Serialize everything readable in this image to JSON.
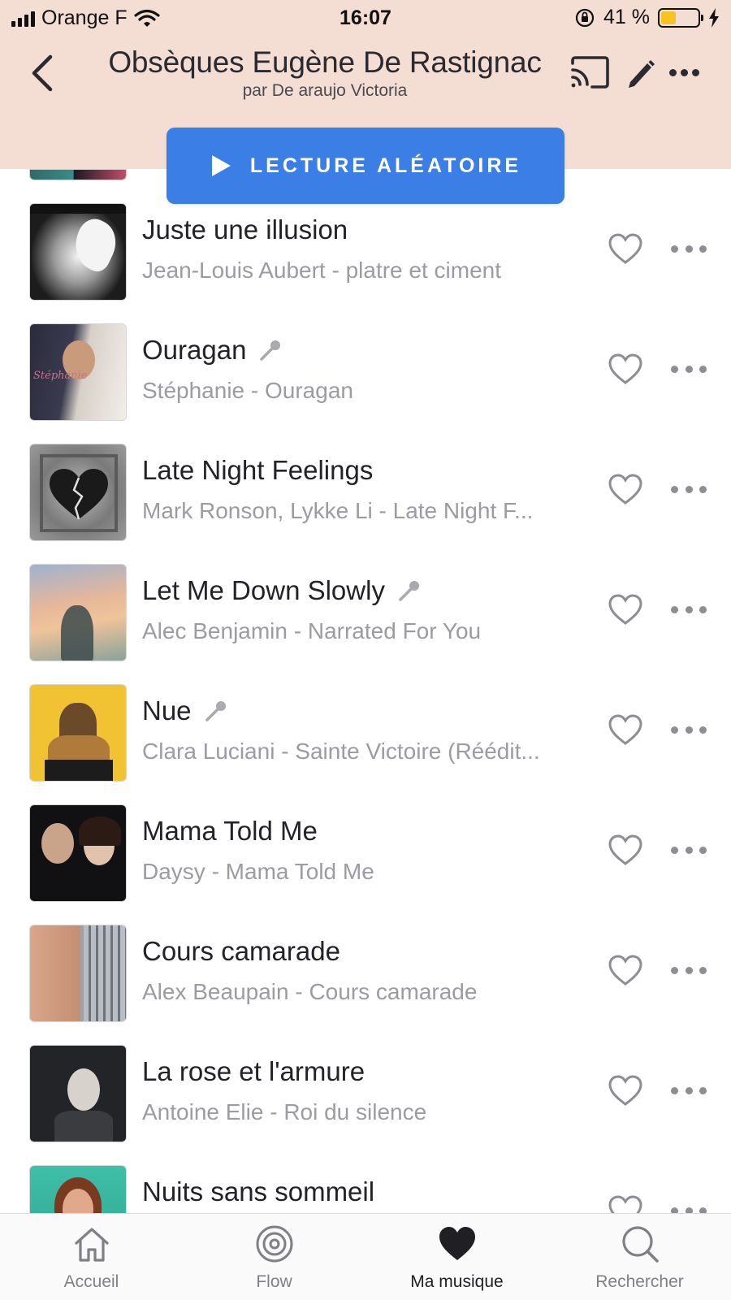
{
  "status_bar": {
    "carrier": "Orange F",
    "time": "16:07",
    "battery_percent": "41 %",
    "battery_level": 0.41
  },
  "header": {
    "title": "Obsèques Eugène De Rastignac",
    "subtitle": "par De araujo Victoria",
    "icons": [
      "back-chevron-icon",
      "cast-icon",
      "pencil-icon",
      "more-icon"
    ]
  },
  "shuffle_button": {
    "label": "LECTURE ALÉATOIRE"
  },
  "tracks": [
    {
      "title": "Juste une illusion",
      "subtitle": "Jean-Louis Aubert - platre et ciment",
      "edited": false
    },
    {
      "title": "Ouragan",
      "subtitle": "Stéphanie - Ouragan",
      "edited": true
    },
    {
      "title": "Late Night Feelings",
      "subtitle": "Mark Ronson, Lykke Li - Late Night F...",
      "edited": false
    },
    {
      "title": "Let Me Down Slowly",
      "subtitle": "Alec Benjamin - Narrated For You",
      "edited": true
    },
    {
      "title": "Nue",
      "subtitle": "Clara Luciani - Sainte Victoire (Réédit...",
      "edited": true
    },
    {
      "title": "Mama Told Me",
      "subtitle": "Daysy - Mama Told Me",
      "edited": false
    },
    {
      "title": "Cours camarade",
      "subtitle": "Alex Beaupain - Cours camarade",
      "edited": false
    },
    {
      "title": "La rose et l'armure",
      "subtitle": "Antoine Elie - Roi du silence",
      "edited": false
    },
    {
      "title": "Nuits sans sommeil",
      "subtitle": "",
      "edited": false
    }
  ],
  "tab_bar": {
    "tabs": [
      {
        "label": "Accueil",
        "icon": "home-icon",
        "active": false
      },
      {
        "label": "Flow",
        "icon": "flow-icon",
        "active": false
      },
      {
        "label": "Ma musique",
        "icon": "heart-filled-icon",
        "active": true
      },
      {
        "label": "Rechercher",
        "icon": "search-icon",
        "active": false
      }
    ]
  },
  "colors": {
    "header_bg": "#f4ddd3",
    "accent_blue": "#3a7ee6",
    "battery_yellow": "#f7c323",
    "secondary_text": "#9b9ba2"
  }
}
